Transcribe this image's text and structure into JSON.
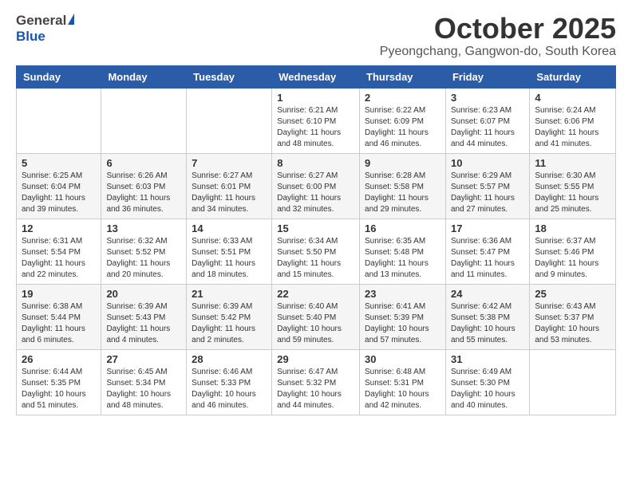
{
  "logo": {
    "general": "General",
    "blue": "Blue"
  },
  "title": {
    "month_year": "October 2025",
    "location": "Pyeongchang, Gangwon-do, South Korea"
  },
  "weekdays": [
    "Sunday",
    "Monday",
    "Tuesday",
    "Wednesday",
    "Thursday",
    "Friday",
    "Saturday"
  ],
  "weeks": [
    [
      {
        "day": "",
        "info": ""
      },
      {
        "day": "",
        "info": ""
      },
      {
        "day": "",
        "info": ""
      },
      {
        "day": "1",
        "info": "Sunrise: 6:21 AM\nSunset: 6:10 PM\nDaylight: 11 hours and 48 minutes."
      },
      {
        "day": "2",
        "info": "Sunrise: 6:22 AM\nSunset: 6:09 PM\nDaylight: 11 hours and 46 minutes."
      },
      {
        "day": "3",
        "info": "Sunrise: 6:23 AM\nSunset: 6:07 PM\nDaylight: 11 hours and 44 minutes."
      },
      {
        "day": "4",
        "info": "Sunrise: 6:24 AM\nSunset: 6:06 PM\nDaylight: 11 hours and 41 minutes."
      }
    ],
    [
      {
        "day": "5",
        "info": "Sunrise: 6:25 AM\nSunset: 6:04 PM\nDaylight: 11 hours and 39 minutes."
      },
      {
        "day": "6",
        "info": "Sunrise: 6:26 AM\nSunset: 6:03 PM\nDaylight: 11 hours and 36 minutes."
      },
      {
        "day": "7",
        "info": "Sunrise: 6:27 AM\nSunset: 6:01 PM\nDaylight: 11 hours and 34 minutes."
      },
      {
        "day": "8",
        "info": "Sunrise: 6:27 AM\nSunset: 6:00 PM\nDaylight: 11 hours and 32 minutes."
      },
      {
        "day": "9",
        "info": "Sunrise: 6:28 AM\nSunset: 5:58 PM\nDaylight: 11 hours and 29 minutes."
      },
      {
        "day": "10",
        "info": "Sunrise: 6:29 AM\nSunset: 5:57 PM\nDaylight: 11 hours and 27 minutes."
      },
      {
        "day": "11",
        "info": "Sunrise: 6:30 AM\nSunset: 5:55 PM\nDaylight: 11 hours and 25 minutes."
      }
    ],
    [
      {
        "day": "12",
        "info": "Sunrise: 6:31 AM\nSunset: 5:54 PM\nDaylight: 11 hours and 22 minutes."
      },
      {
        "day": "13",
        "info": "Sunrise: 6:32 AM\nSunset: 5:52 PM\nDaylight: 11 hours and 20 minutes."
      },
      {
        "day": "14",
        "info": "Sunrise: 6:33 AM\nSunset: 5:51 PM\nDaylight: 11 hours and 18 minutes."
      },
      {
        "day": "15",
        "info": "Sunrise: 6:34 AM\nSunset: 5:50 PM\nDaylight: 11 hours and 15 minutes."
      },
      {
        "day": "16",
        "info": "Sunrise: 6:35 AM\nSunset: 5:48 PM\nDaylight: 11 hours and 13 minutes."
      },
      {
        "day": "17",
        "info": "Sunrise: 6:36 AM\nSunset: 5:47 PM\nDaylight: 11 hours and 11 minutes."
      },
      {
        "day": "18",
        "info": "Sunrise: 6:37 AM\nSunset: 5:46 PM\nDaylight: 11 hours and 9 minutes."
      }
    ],
    [
      {
        "day": "19",
        "info": "Sunrise: 6:38 AM\nSunset: 5:44 PM\nDaylight: 11 hours and 6 minutes."
      },
      {
        "day": "20",
        "info": "Sunrise: 6:39 AM\nSunset: 5:43 PM\nDaylight: 11 hours and 4 minutes."
      },
      {
        "day": "21",
        "info": "Sunrise: 6:39 AM\nSunset: 5:42 PM\nDaylight: 11 hours and 2 minutes."
      },
      {
        "day": "22",
        "info": "Sunrise: 6:40 AM\nSunset: 5:40 PM\nDaylight: 10 hours and 59 minutes."
      },
      {
        "day": "23",
        "info": "Sunrise: 6:41 AM\nSunset: 5:39 PM\nDaylight: 10 hours and 57 minutes."
      },
      {
        "day": "24",
        "info": "Sunrise: 6:42 AM\nSunset: 5:38 PM\nDaylight: 10 hours and 55 minutes."
      },
      {
        "day": "25",
        "info": "Sunrise: 6:43 AM\nSunset: 5:37 PM\nDaylight: 10 hours and 53 minutes."
      }
    ],
    [
      {
        "day": "26",
        "info": "Sunrise: 6:44 AM\nSunset: 5:35 PM\nDaylight: 10 hours and 51 minutes."
      },
      {
        "day": "27",
        "info": "Sunrise: 6:45 AM\nSunset: 5:34 PM\nDaylight: 10 hours and 48 minutes."
      },
      {
        "day": "28",
        "info": "Sunrise: 6:46 AM\nSunset: 5:33 PM\nDaylight: 10 hours and 46 minutes."
      },
      {
        "day": "29",
        "info": "Sunrise: 6:47 AM\nSunset: 5:32 PM\nDaylight: 10 hours and 44 minutes."
      },
      {
        "day": "30",
        "info": "Sunrise: 6:48 AM\nSunset: 5:31 PM\nDaylight: 10 hours and 42 minutes."
      },
      {
        "day": "31",
        "info": "Sunrise: 6:49 AM\nSunset: 5:30 PM\nDaylight: 10 hours and 40 minutes."
      },
      {
        "day": "",
        "info": ""
      }
    ]
  ]
}
